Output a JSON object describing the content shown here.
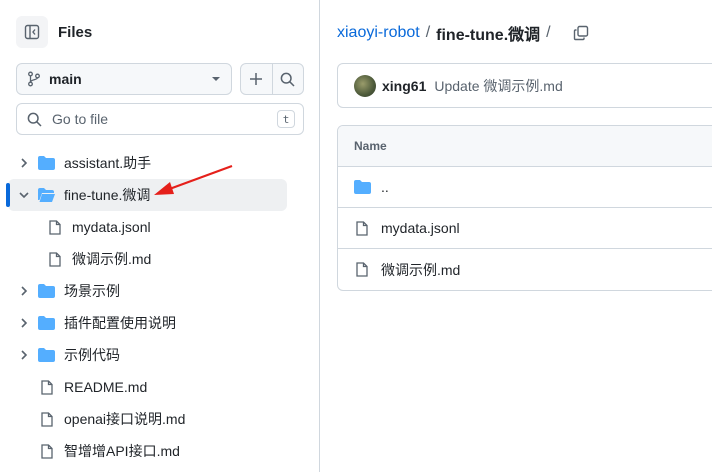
{
  "sidebar": {
    "title": "Files",
    "branch": "main",
    "search_placeholder": "Go to file",
    "search_shortcut": "t",
    "tree": [
      {
        "label": "assistant.助手",
        "type": "folder",
        "depth": 0,
        "expanded": false,
        "selected": false
      },
      {
        "label": "fine-tune.微调",
        "type": "folder",
        "depth": 0,
        "expanded": true,
        "selected": true
      },
      {
        "label": "mydata.jsonl",
        "type": "file",
        "depth": 1,
        "selected": false
      },
      {
        "label": "微调示例.md",
        "type": "file",
        "depth": 1,
        "selected": false
      },
      {
        "label": "场景示例",
        "type": "folder",
        "depth": 0,
        "expanded": false,
        "selected": false
      },
      {
        "label": "插件配置使用说明",
        "type": "folder",
        "depth": 0,
        "expanded": false,
        "selected": false
      },
      {
        "label": "示例代码",
        "type": "folder",
        "depth": 0,
        "expanded": false,
        "selected": false
      },
      {
        "label": "README.md",
        "type": "file",
        "depth": 0,
        "selected": false
      },
      {
        "label": "openai接口说明.md",
        "type": "file",
        "depth": 0,
        "selected": false
      },
      {
        "label": "智增增API接口.md",
        "type": "file",
        "depth": 0,
        "selected": false
      }
    ]
  },
  "breadcrumb": {
    "repo": "xiaoyi-robot",
    "separator": "/",
    "current": "fine-tune.微调",
    "trailing": "/"
  },
  "commit": {
    "user": "xing61",
    "message": "Update 微调示例.md"
  },
  "table": {
    "header": "Name",
    "rows": [
      {
        "name": "..",
        "type": "folder"
      },
      {
        "name": "mydata.jsonl",
        "type": "file"
      },
      {
        "name": "微调示例.md",
        "type": "file"
      }
    ]
  },
  "colors": {
    "accent": "#0969da",
    "folder": "#54aeff",
    "border": "#d0d7de",
    "annotation": "#e5201b"
  }
}
